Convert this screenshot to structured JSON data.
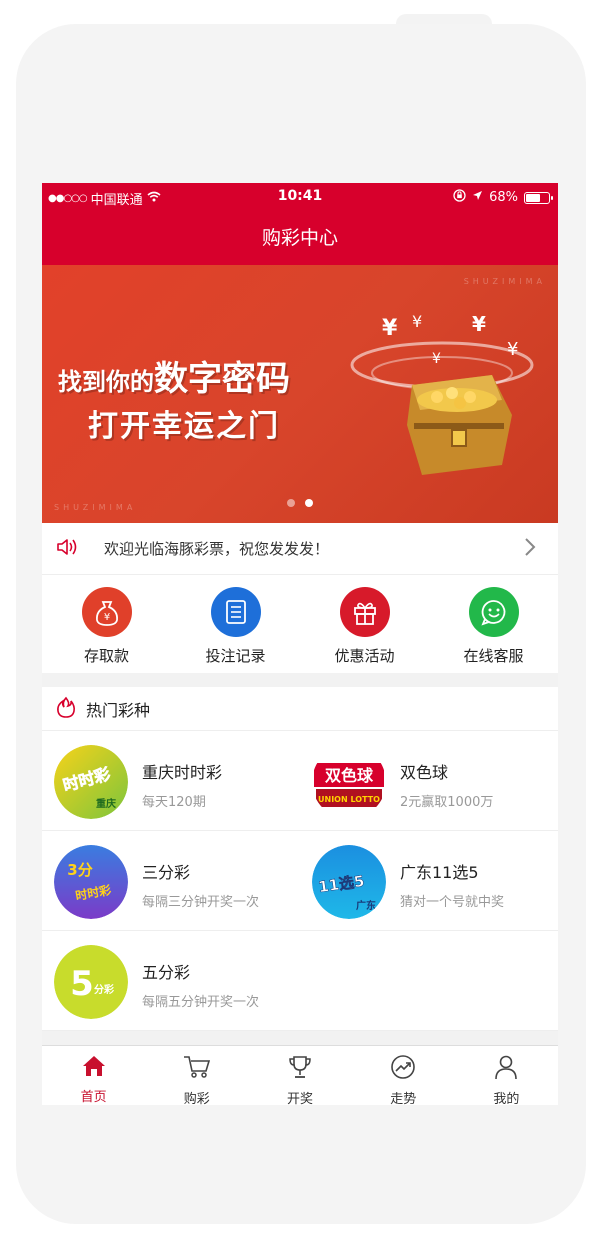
{
  "status_bar": {
    "carrier": "中国联通",
    "time": "10:41",
    "battery": "68%",
    "battery_level": 0.68
  },
  "nav": {
    "title": "购彩中心"
  },
  "banner": {
    "watermark_top": "SHUZIMIMA",
    "watermark_bottom": "SHUZIMIMA",
    "line1_prefix": "找到你的",
    "line1_emphasis": "数字密码",
    "line2": "打开幸运之门",
    "pages": 2,
    "active_page": 2
  },
  "notice": {
    "text": "欢迎光临海豚彩票，祝您发发发！"
  },
  "quick_actions": [
    {
      "label": "存取款",
      "icon": "money-bag-icon",
      "color": "#e0402a"
    },
    {
      "label": "投注记录",
      "icon": "list-icon",
      "color": "#1e6fd9"
    },
    {
      "label": "优惠活动",
      "icon": "gift-icon",
      "color": "#d71a2a"
    },
    {
      "label": "在线客服",
      "icon": "smile-chat-icon",
      "color": "#22b84a"
    }
  ],
  "hot_section": {
    "title": "热门彩种"
  },
  "games": [
    {
      "name": "重庆时时彩",
      "desc": "每天120期",
      "logo_text": "时时彩",
      "logo_sub": "重庆"
    },
    {
      "name": "双色球",
      "desc": "2元赢取1000万",
      "logo_text": "双色球",
      "logo_sub": "UNION LOTTO"
    },
    {
      "name": "三分彩",
      "desc": "每隔三分钟开奖一次",
      "logo_text": "3分",
      "logo_sub": "时时彩"
    },
    {
      "name": "广东11选5",
      "desc": "猜对一个号就中奖",
      "logo_text": "11选5",
      "logo_sub": "广东"
    },
    {
      "name": "五分彩",
      "desc": "每隔五分钟开奖一次",
      "logo_text": "5",
      "logo_sub": "分彩"
    }
  ],
  "tabs": [
    {
      "label": "首页",
      "icon": "home-icon",
      "active": true
    },
    {
      "label": "购彩",
      "icon": "cart-icon",
      "active": false
    },
    {
      "label": "开奖",
      "icon": "trophy-icon",
      "active": false
    },
    {
      "label": "走势",
      "icon": "trend-icon",
      "active": false
    },
    {
      "label": "我的",
      "icon": "person-icon",
      "active": false
    }
  ],
  "colors": {
    "brand_red": "#d7002c",
    "tab_active": "#c8102e"
  }
}
